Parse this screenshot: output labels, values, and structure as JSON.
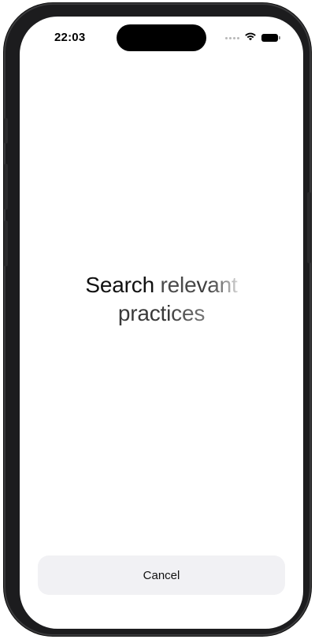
{
  "status_bar": {
    "time": "22:03",
    "icons": [
      "signal-dots-icon",
      "wifi-icon",
      "battery-icon"
    ]
  },
  "headline": {
    "line1": {
      "word1": "Search",
      "word2_start": "rele",
      "word2_end": "vant"
    },
    "line2": {
      "start": "practi",
      "end": "ces"
    }
  },
  "cancel_button": {
    "label": "Cancel"
  },
  "colors": {
    "background": "#ffffff",
    "device_frame": "#1c1c1e",
    "button_background": "#f1f1f4",
    "text": "#111111"
  }
}
